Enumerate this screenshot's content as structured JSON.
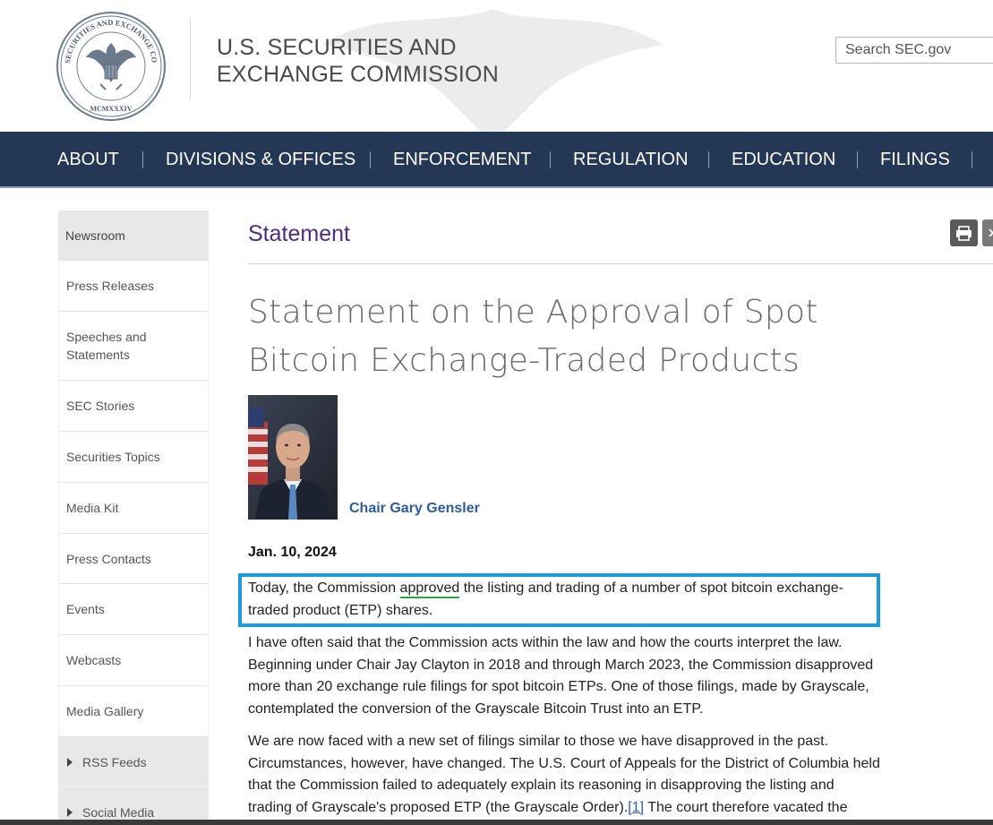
{
  "header": {
    "title_line1": "U.S. SECURITIES AND",
    "title_line2": "EXCHANGE COMMISSION",
    "seal_text": "SECURITIES AND EXCHANGE COMMISSION",
    "seal_year": "MCMXXXIV",
    "search_placeholder": "Search SEC.gov"
  },
  "nav": {
    "items": [
      "ABOUT",
      "DIVISIONS & OFFICES",
      "ENFORCEMENT",
      "REGULATION",
      "EDUCATION",
      "FILINGS"
    ]
  },
  "sidebar": {
    "items": [
      "Newsroom",
      "Press Releases",
      "Speeches and Statements",
      "SEC Stories",
      "Securities Topics",
      "Media Kit",
      "Press Contacts",
      "Events",
      "Webcasts",
      "Media Gallery",
      "RSS Feeds",
      "Social Media"
    ]
  },
  "article": {
    "section_label": "Statement",
    "headline_line1": "Statement on the Approval of Spot",
    "headline_line2": "Bitcoin Exchange-Traded Products",
    "author": "Chair Gary Gensler",
    "date": "Jan. 10, 2024",
    "p1_a": "Today, the Commission ",
    "p1_underlined": "approved",
    "p1_b": " the listing and trading of a number of spot bitcoin exchange-",
    "p1_line2": "traded product (ETP) shares.",
    "p2_lines": [
      "I have often said that the Commission acts within the law and how the courts interpret the law.",
      "Beginning under Chair Jay Clayton in 2018 and through March 2023, the Commission disapproved",
      "more than 20 exchange rule filings for spot bitcoin ETPs. One of those filings, made by Grayscale,",
      "contemplated the conversion of the Grayscale Bitcoin Trust into an ETP."
    ],
    "p3_lines": [
      "We are now faced with a new set of filings similar to those we have disapproved in the past.",
      "Circumstances, however, have changed. The U.S. Court of Appeals for the District of Columbia held",
      "that the Commission failed to adequately explain its reasoning in disapproving the listing and"
    ],
    "p3_line4_a": "trading of Grayscale's proposed ETP (the Grayscale Order).",
    "p3_footnote": "[1]",
    "p3_line4_b": " The court therefore vacated the"
  },
  "colors": {
    "nav_bg": "#243754",
    "section_label": "#4b2e83",
    "link": "#2f5b9a",
    "highlight_border": "#1e9bd7",
    "underline": "#2aa745"
  },
  "icons": [
    "sec-seal-logo",
    "eagle-watermark",
    "print-icon",
    "share-icon",
    "caret-right-icon"
  ]
}
